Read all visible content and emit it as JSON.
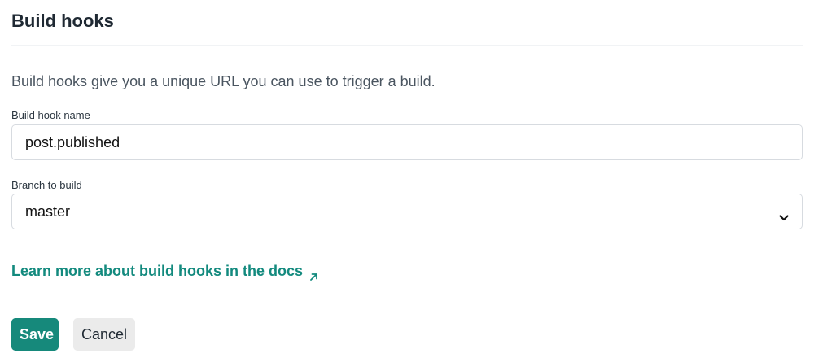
{
  "section": {
    "title": "Build hooks",
    "description": "Build hooks give you a unique URL you can use to trigger a build."
  },
  "form": {
    "name_label": "Build hook name",
    "name_value": "post.published",
    "branch_label": "Branch to build",
    "branch_value": "master"
  },
  "docs_link": {
    "text": "Learn more about build hooks in the docs",
    "icon": "external-arrow-icon"
  },
  "actions": {
    "save_label": "Save",
    "cancel_label": "Cancel"
  },
  "colors": {
    "accent": "#138a7e",
    "save_bg": "#16897b",
    "cancel_bg": "#ebebeb"
  }
}
